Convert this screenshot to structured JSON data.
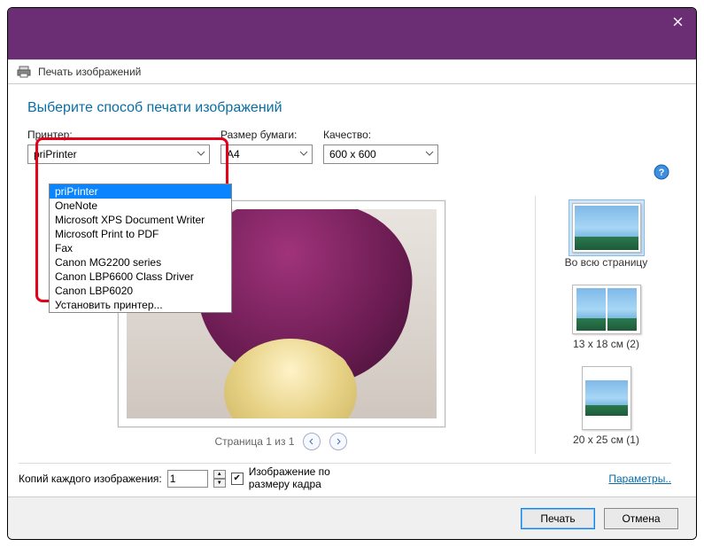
{
  "titlebar": {
    "window_title": ""
  },
  "header": {
    "title": "Печать изображений"
  },
  "instruction": "Выберите способ печати изображений",
  "controls": {
    "printer": {
      "label": "Принтер:",
      "selected": "priPrinter"
    },
    "paper": {
      "label": "Размер бумаги:",
      "selected": "A4"
    },
    "quality": {
      "label": "Качество:",
      "selected": "600 x 600"
    }
  },
  "printer_options": [
    "priPrinter",
    "OneNote",
    "Microsoft XPS Document Writer",
    "Microsoft Print to PDF",
    "Fax",
    "Canon MG2200 series",
    "Canon LBP6600 Class Driver",
    "Canon LBP6020",
    "Установить принтер..."
  ],
  "pager": {
    "text": "Страница 1 из 1"
  },
  "layouts": [
    {
      "label": "Во всю страницу"
    },
    {
      "label": "13 x 18 см (2)"
    },
    {
      "label": "20 x 25 см (1)"
    }
  ],
  "bottom": {
    "copies_label": "Копий каждого изображения:",
    "copies_value": "1",
    "fit_label": "Изображение по\nразмеру кадра",
    "params_link": "Параметры.."
  },
  "buttons": {
    "print": "Печать",
    "cancel": "Отмена"
  }
}
